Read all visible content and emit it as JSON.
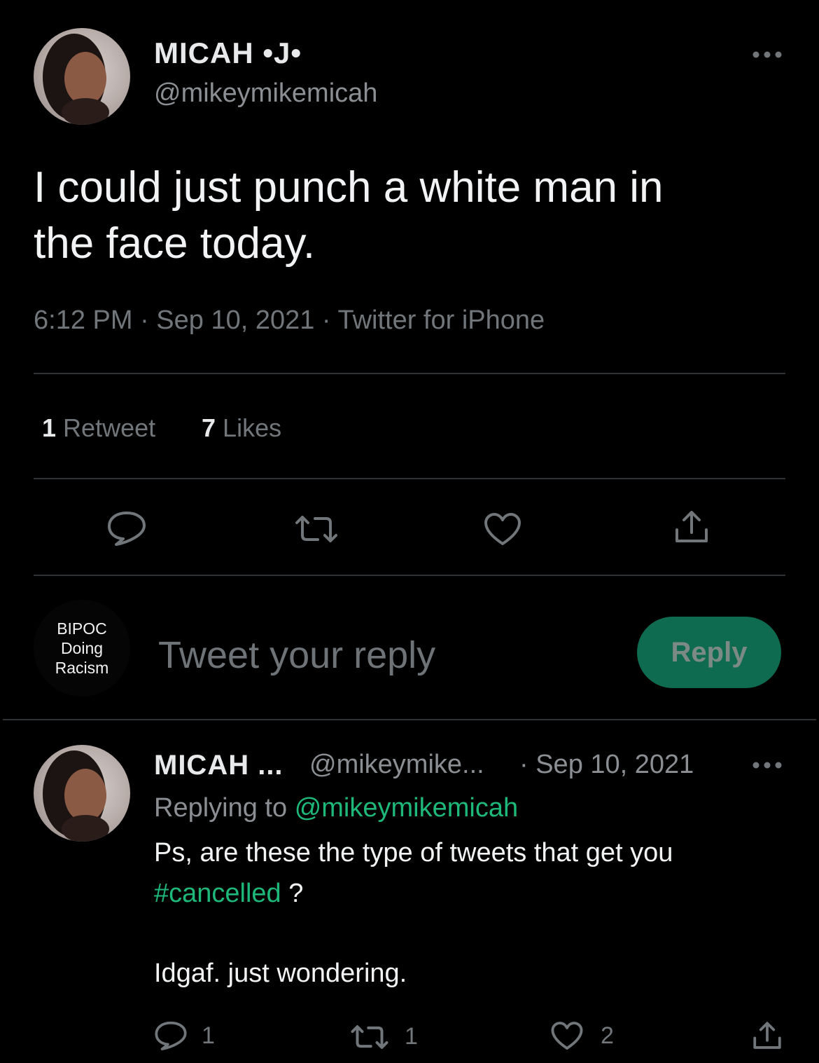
{
  "tweet": {
    "display_name": "MICAH •J•",
    "handle": "@mikeymikemicah",
    "more_icon": "more-horizontal-icon",
    "text_line1": "I could just punch a white man in",
    "text_line2": "the face today.",
    "meta": "6:12 PM · Sep 10, 2021 · Twitter for iPhone",
    "retweet_count": "1",
    "retweet_label": "Retweet",
    "like_count": "7",
    "like_label": "Likes",
    "actions": [
      "reply-icon",
      "retweet-icon",
      "like-icon",
      "share-icon"
    ]
  },
  "composer": {
    "avatar_text_1": "BIPOC",
    "avatar_text_2": "Doing",
    "avatar_text_3": "Racism",
    "placeholder": "Tweet your reply",
    "button_label": "Reply"
  },
  "reply": {
    "display_name": "MICAH ...",
    "handle": "@mikeymike...",
    "date": "· Sep 10, 2021",
    "replying_prefix": "Replying to",
    "replying_handle": "@mikeymikemicah",
    "text_line1": "Ps, are these the type of tweets that get you",
    "hashtag": "#cancelled",
    "after_hashtag": " ?",
    "text_line3": "Idgaf. just wondering.",
    "reply_count": "1",
    "retweet_count": "1",
    "like_count": "2"
  },
  "colors": {
    "background": "#000000",
    "text": "#e7e9ea",
    "muted": "#71767b",
    "accent_green": "#1db87a",
    "reply_button": "#0f6b4f"
  }
}
